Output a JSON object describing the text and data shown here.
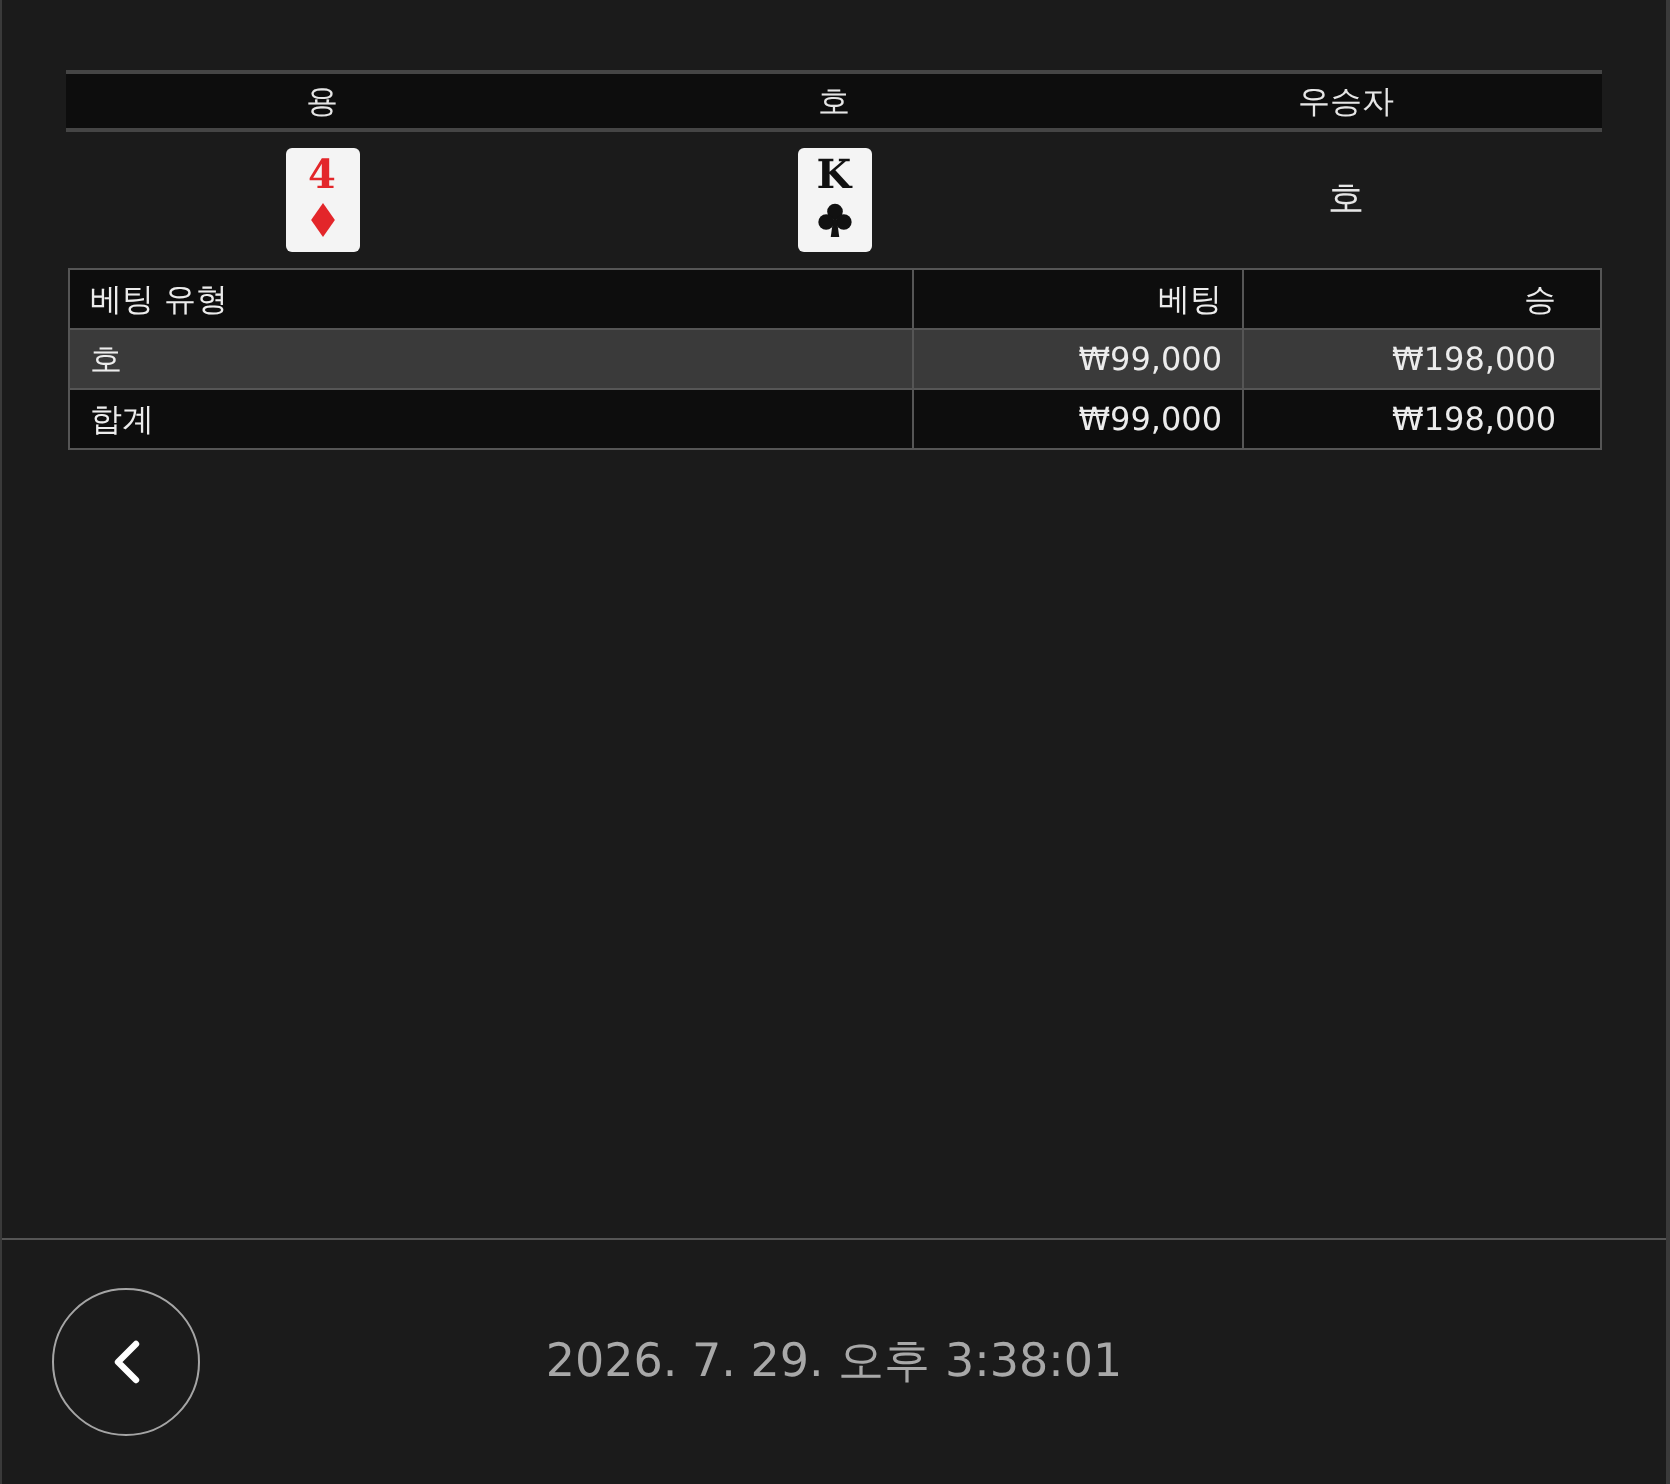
{
  "results": {
    "columns": [
      "용",
      "호",
      "우승자"
    ],
    "cards": [
      {
        "rank": "4",
        "kind": "diamond"
      },
      {
        "rank": "K",
        "kind": "club"
      }
    ],
    "winner": "호"
  },
  "bets": {
    "columns": [
      "베팅 유형",
      "베팅",
      "승"
    ],
    "rows": [
      {
        "cells": [
          "호",
          "₩99,000",
          "₩198,000"
        ],
        "highlighted": true
      },
      {
        "cells": [
          "합계",
          "₩99,000",
          "₩198,000"
        ],
        "highlighted": false
      }
    ]
  },
  "footer": {
    "timestamp": "2026. 7. 29. 오후 3:38:01"
  }
}
